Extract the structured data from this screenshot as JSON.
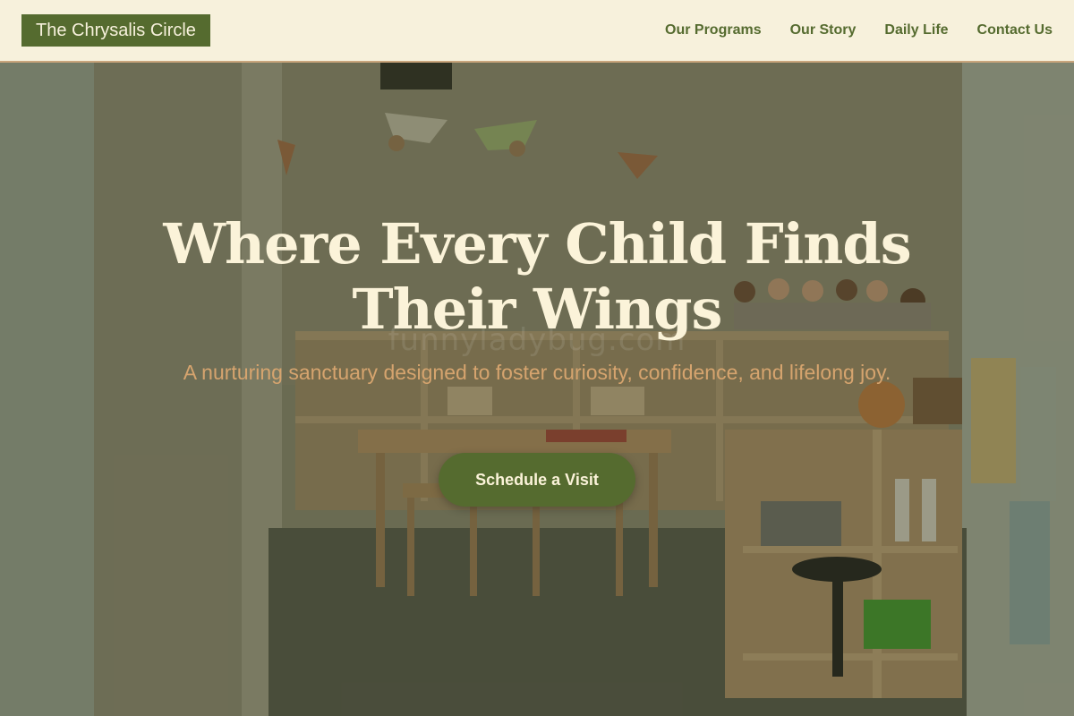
{
  "header": {
    "logo_text": "The Chrysalis Circle",
    "nav": [
      {
        "label": "Our Programs"
      },
      {
        "label": "Our Story"
      },
      {
        "label": "Daily Life"
      },
      {
        "label": "Contact Us"
      }
    ]
  },
  "hero": {
    "headline": "Where Every Child Finds Their Wings",
    "subtitle": "A nurturing sanctuary designed to foster curiosity, confidence, and lifelong joy.",
    "cta_label": "Schedule a Visit",
    "background_image": "classroom-photo",
    "watermark": "funnyladybug.com"
  },
  "colors": {
    "brand_green": "#556b2f",
    "cream": "#f7f1dc",
    "accent_tan": "#d6a46e",
    "header_border": "#c9a57c"
  }
}
